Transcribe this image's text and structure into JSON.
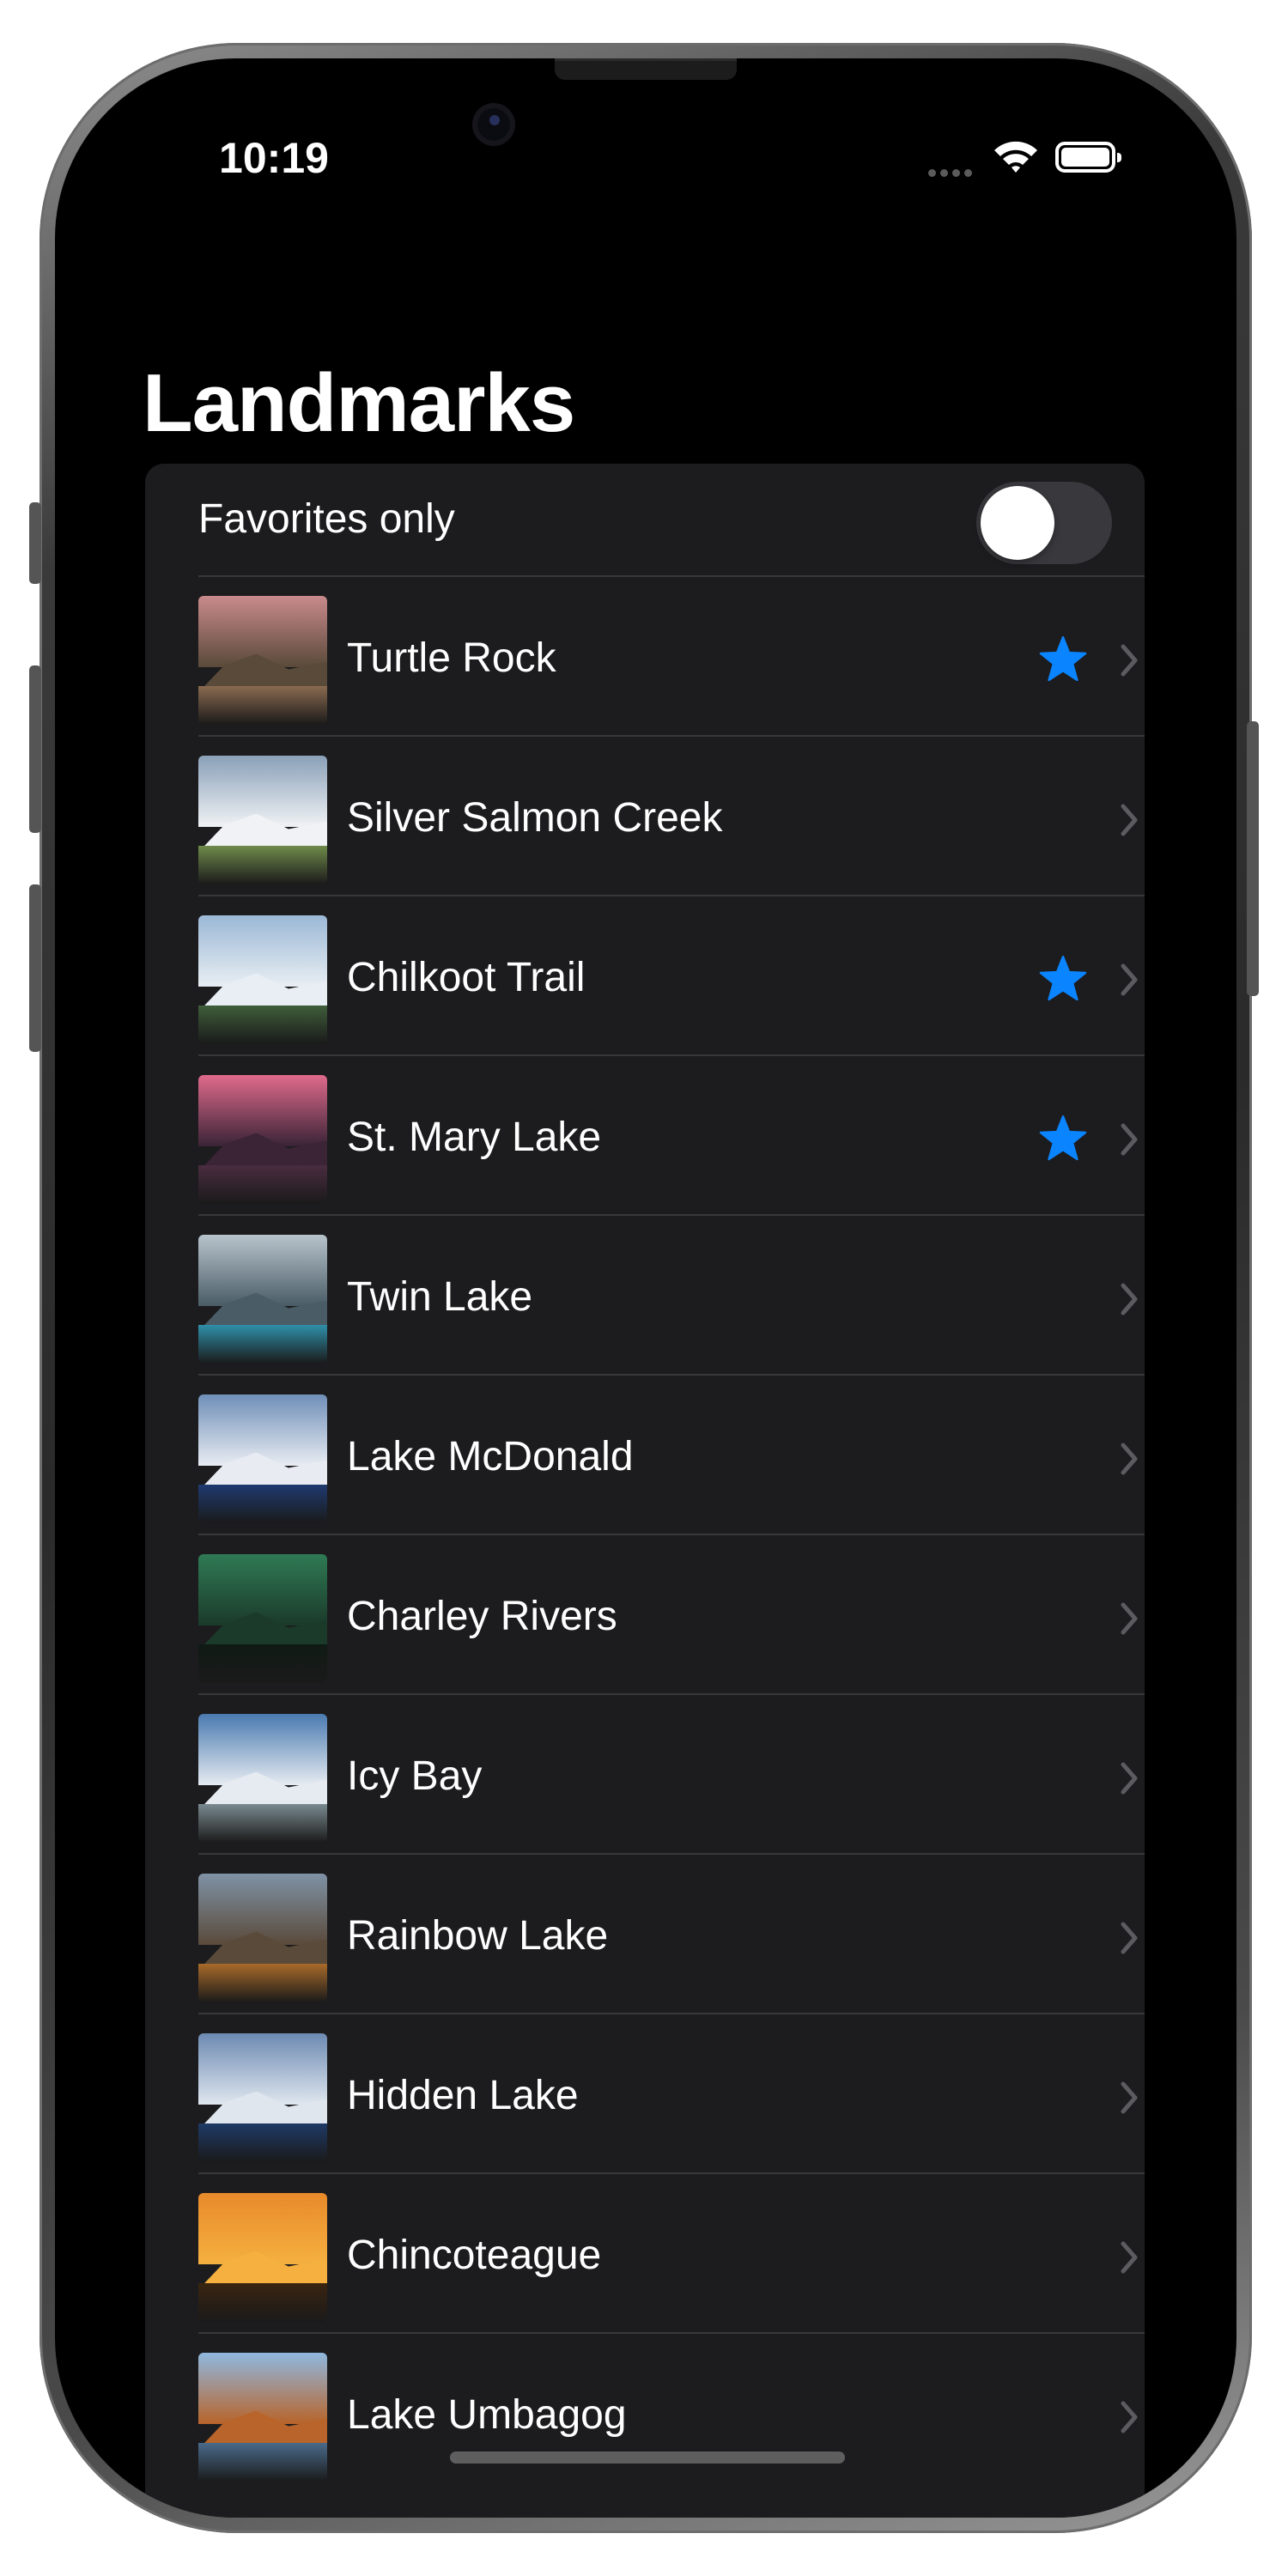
{
  "status_bar": {
    "time": "10:19"
  },
  "page": {
    "title": "Landmarks"
  },
  "favorites_toggle": {
    "label": "Favorites only",
    "on": false
  },
  "accent_color": "#0a84ff",
  "landmarks": [
    {
      "name": "Turtle Rock",
      "favorite": true,
      "thumb": [
        "#c98a8c",
        "#5a4a3a",
        "#8a6a50"
      ]
    },
    {
      "name": "Silver Salmon Creek",
      "favorite": false,
      "thumb": [
        "#8aa0b8",
        "#f0f2f5",
        "#6f8a4a"
      ]
    },
    {
      "name": "Chilkoot Trail",
      "favorite": true,
      "thumb": [
        "#9bb8d6",
        "#e8eef3",
        "#3f5e3a"
      ]
    },
    {
      "name": "St. Mary Lake",
      "favorite": true,
      "thumb": [
        "#e06a8c",
        "#3a2436",
        "#4a2c40"
      ]
    },
    {
      "name": "Twin Lake",
      "favorite": false,
      "thumb": [
        "#b8c4cc",
        "#4a5c66",
        "#2f8fa8"
      ]
    },
    {
      "name": "Lake McDonald",
      "favorite": false,
      "thumb": [
        "#6f8fb8",
        "#e8ecf2",
        "#1f3a70"
      ]
    },
    {
      "name": "Charley Rivers",
      "favorite": false,
      "thumb": [
        "#2f7a55",
        "#1b3a2a",
        "#101a14"
      ]
    },
    {
      "name": "Icy Bay",
      "favorite": false,
      "thumb": [
        "#4a7ab0",
        "#e6ebf1",
        "#7a8a90"
      ]
    },
    {
      "name": "Rainbow Lake",
      "favorite": false,
      "thumb": [
        "#7f92a6",
        "#5a4a3a",
        "#a86a2a"
      ]
    },
    {
      "name": "Hidden Lake",
      "favorite": false,
      "thumb": [
        "#6c8ab2",
        "#dfe6ee",
        "#1f3a66"
      ]
    },
    {
      "name": "Chincoteague",
      "favorite": false,
      "thumb": [
        "#e88a2a",
        "#f5b040",
        "#3a2410"
      ]
    },
    {
      "name": "Lake Umbagog",
      "favorite": false,
      "thumb": [
        "#8fb8e0",
        "#b8642a",
        "#4a6a8a"
      ]
    }
  ]
}
